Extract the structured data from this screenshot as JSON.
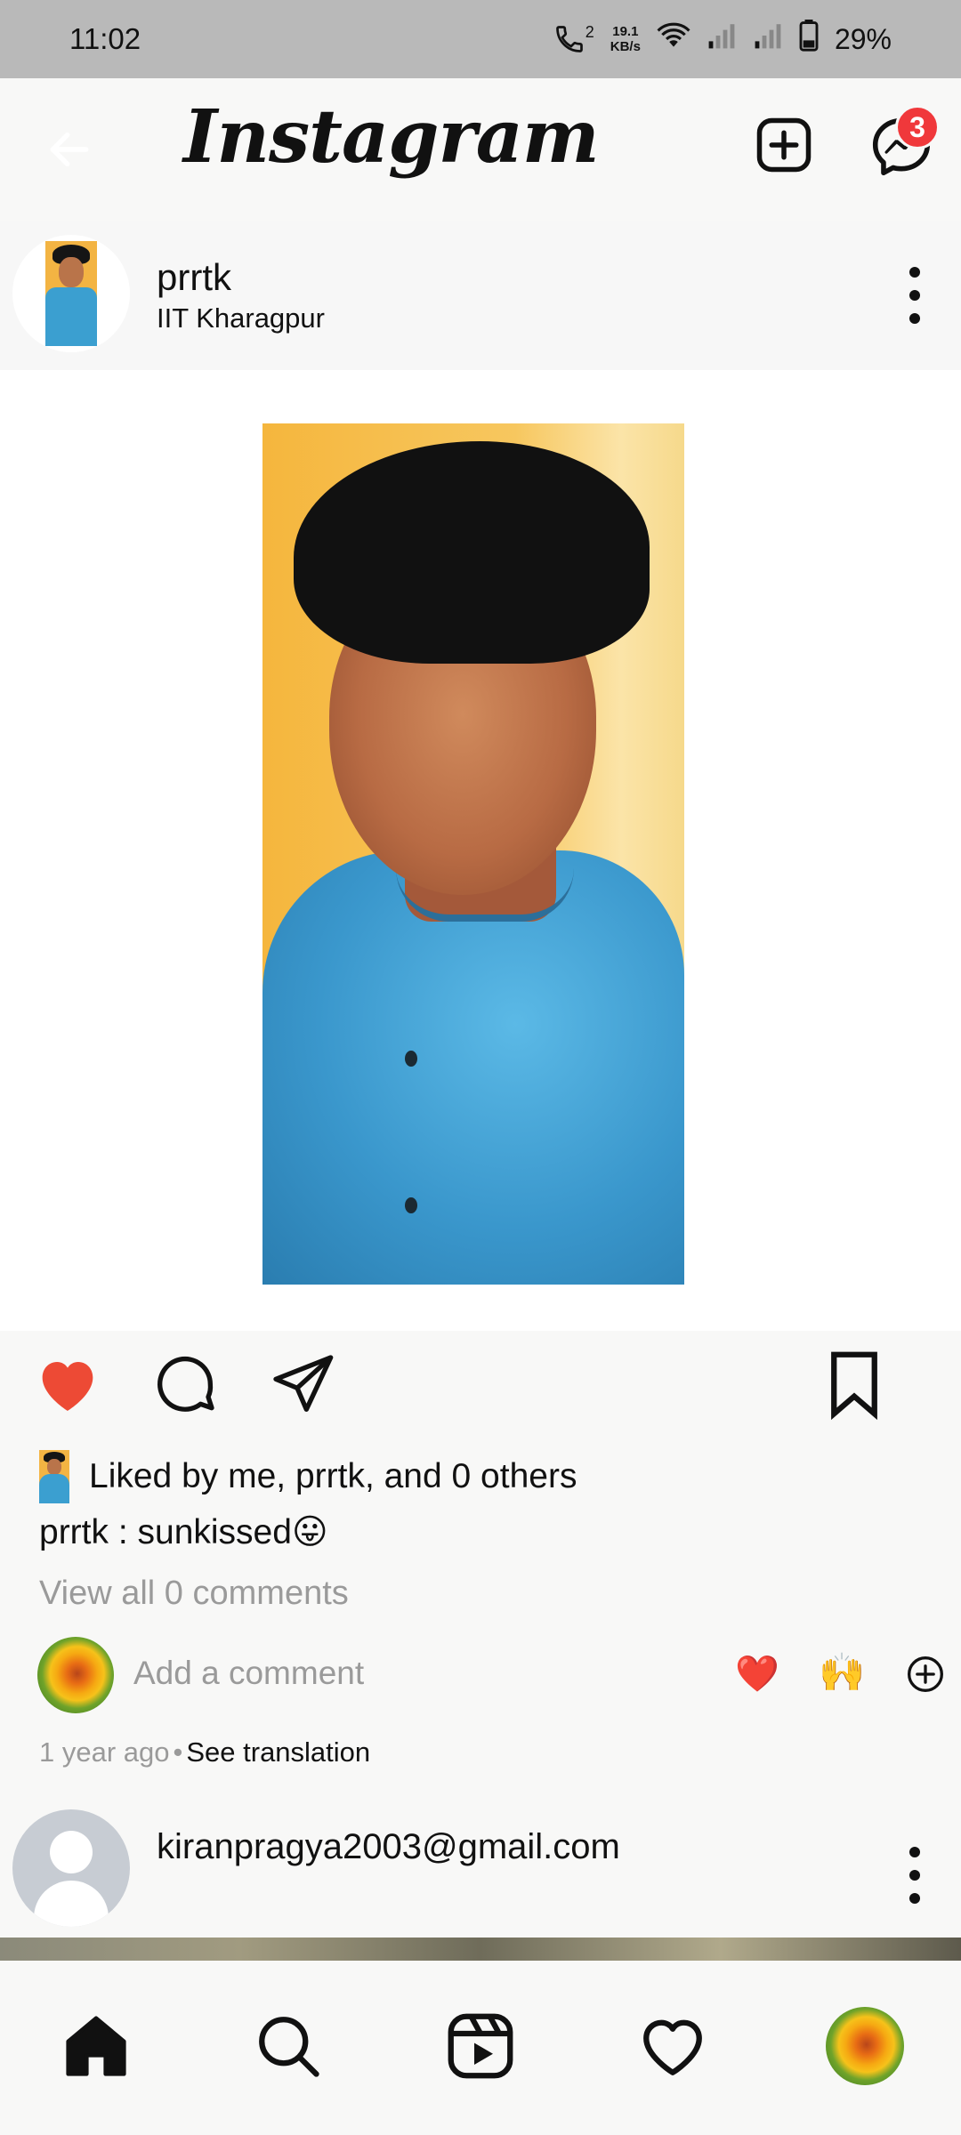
{
  "status_bar": {
    "time": "11:02",
    "net_speed_value": "19.1",
    "net_speed_unit": "KB/s",
    "battery": "29%",
    "call_icon": "volte-call-icon",
    "sim_label": "2"
  },
  "header": {
    "app_title": "Instagram",
    "messages_badge": "3",
    "icons": [
      "back-arrow-icon",
      "create-post-icon",
      "messenger-icon"
    ]
  },
  "post": {
    "username": "prrtk",
    "location": "IIT Kharagpur",
    "liked_by": "Liked by me, prrtk, and 0 others",
    "caption": "prrtk : sunkissed😛",
    "view_comments": "View all 0 comments",
    "comment_placeholder": "Add a comment",
    "quick_reactions": [
      "❤️",
      "🙌"
    ],
    "timestamp": "1 year ago",
    "see_translation": "See translation",
    "liked": true,
    "colors": {
      "like_red": "#ed4a35"
    }
  },
  "next_post": {
    "username": "kiranpragya2003@gmail.com"
  },
  "bottom_nav": {
    "items": [
      "home-icon",
      "search-icon",
      "reels-icon",
      "activity-heart-icon",
      "profile-avatar"
    ]
  }
}
